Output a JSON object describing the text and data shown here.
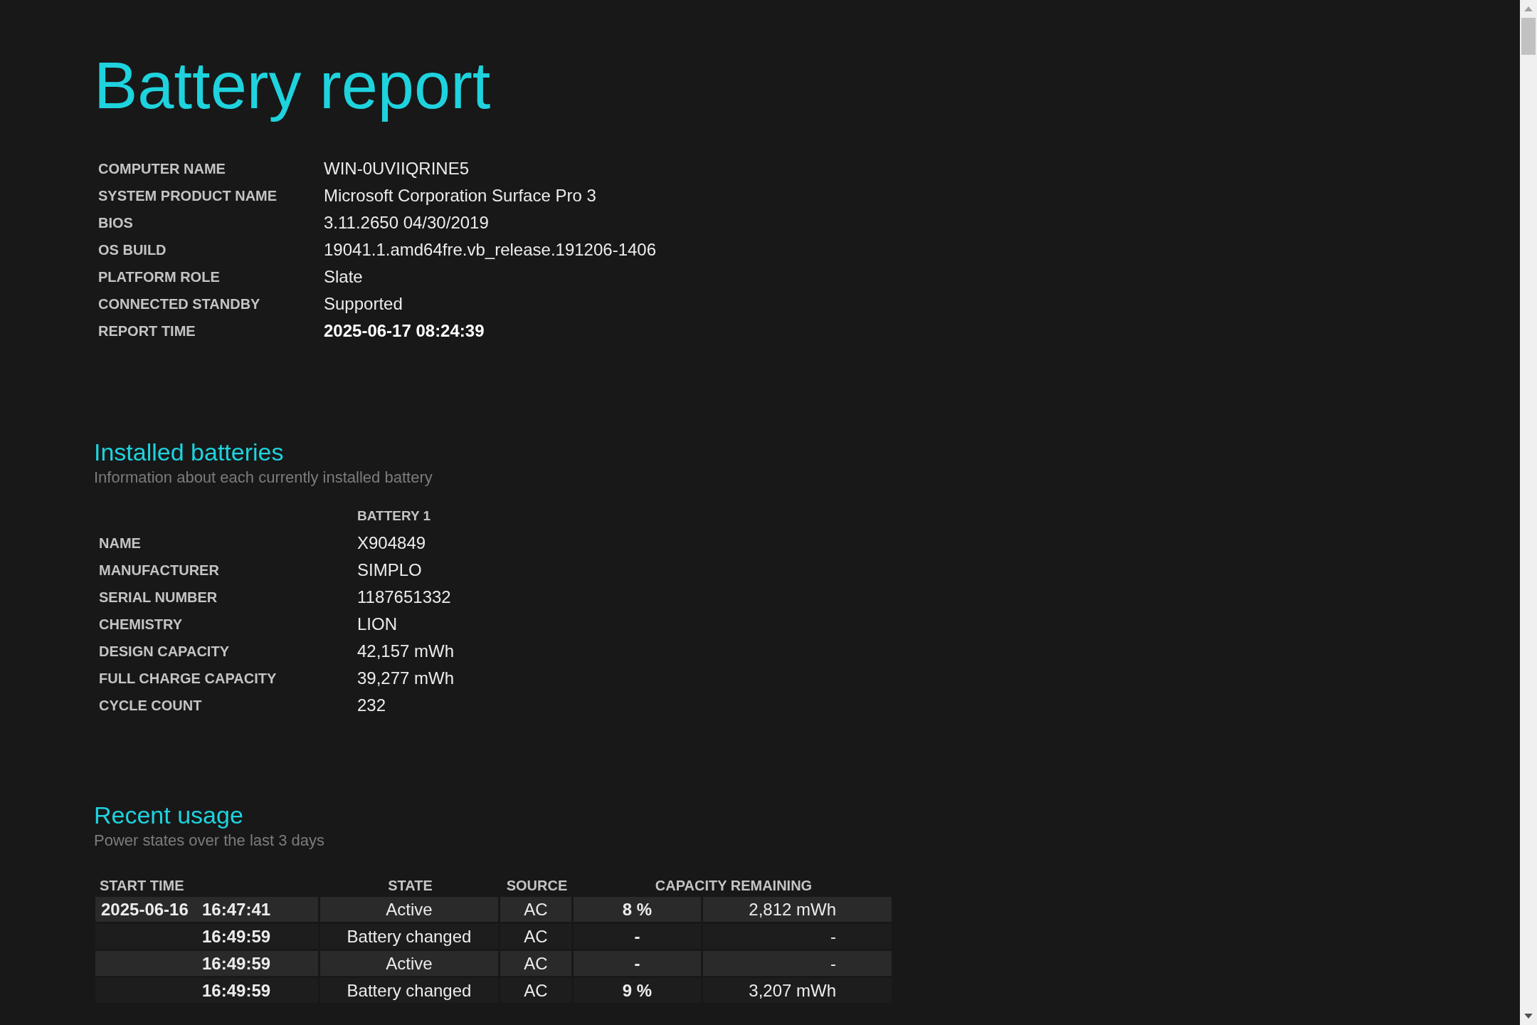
{
  "title": "Battery report",
  "system_info": [
    {
      "label": "COMPUTER NAME",
      "value": "WIN-0UVIIQRINE5",
      "bold": false
    },
    {
      "label": "SYSTEM PRODUCT NAME",
      "value": "Microsoft Corporation Surface Pro 3",
      "bold": false
    },
    {
      "label": "BIOS",
      "value": "3.11.2650 04/30/2019",
      "bold": false
    },
    {
      "label": "OS BUILD",
      "value": "19041.1.amd64fre.vb_release.191206-1406",
      "bold": false
    },
    {
      "label": "PLATFORM ROLE",
      "value": "Slate",
      "bold": false
    },
    {
      "label": "CONNECTED STANDBY",
      "value": "Supported",
      "bold": false
    },
    {
      "label": "REPORT TIME",
      "value": "2025-06-17  08:24:39",
      "bold": true
    }
  ],
  "installed_batteries": {
    "heading": "Installed batteries",
    "subtitle": "Information about each currently installed battery",
    "column": "BATTERY 1",
    "rows": [
      {
        "label": "NAME",
        "value": "X904849"
      },
      {
        "label": "MANUFACTURER",
        "value": "SIMPLO"
      },
      {
        "label": "SERIAL NUMBER",
        "value": "1187651332"
      },
      {
        "label": "CHEMISTRY",
        "value": "LION"
      },
      {
        "label": "DESIGN CAPACITY",
        "value": "42,157 mWh"
      },
      {
        "label": "FULL CHARGE CAPACITY",
        "value": "39,277 mWh"
      },
      {
        "label": "CYCLE COUNT",
        "value": "232"
      }
    ]
  },
  "recent_usage": {
    "heading": "Recent usage",
    "subtitle": "Power states over the last 3 days",
    "columns": [
      "START TIME",
      "STATE",
      "SOURCE",
      "CAPACITY REMAINING"
    ],
    "rows": [
      {
        "date": "2025-06-16",
        "time": "16:47:41",
        "state": "Active",
        "source": "AC",
        "percent": "8 %",
        "energy": "2,812 mWh"
      },
      {
        "time": "16:49:59",
        "state": "Battery changed",
        "source": "AC",
        "percent": "-",
        "energy": "-"
      },
      {
        "time": "16:49:59",
        "state": "Active",
        "source": "AC",
        "percent": "-",
        "energy": "-"
      },
      {
        "time": "16:49:59",
        "state": "Battery changed",
        "source": "AC",
        "percent": "9 %",
        "energy": "3,207 mWh"
      }
    ]
  }
}
